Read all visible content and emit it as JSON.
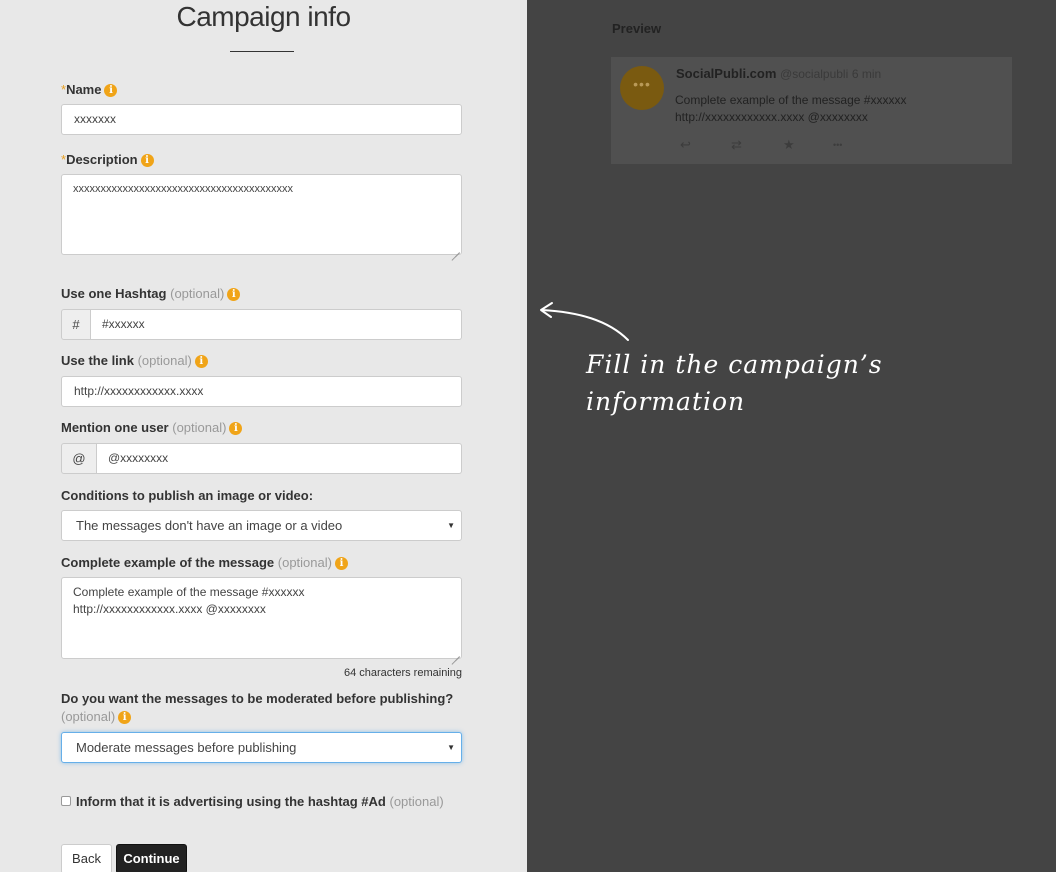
{
  "form": {
    "title": "Campaign info",
    "name": {
      "required_mark": "*",
      "label": "Name",
      "value": "xxxxxxx"
    },
    "description": {
      "required_mark": "*",
      "label": "Description",
      "value": "xxxxxxxxxxxxxxxxxxxxxxxxxxxxxxxxxxxxxxxx"
    },
    "hashtag": {
      "label": "Use one Hashtag",
      "optional": "(optional)",
      "addon": "#",
      "value": "#xxxxxx"
    },
    "link": {
      "label": "Use the link",
      "optional": "(optional)",
      "value": "http://xxxxxxxxxxxx.xxxx"
    },
    "mention": {
      "label": "Mention one user",
      "optional": "(optional)",
      "addon": "@",
      "value": "@xxxxxxxx"
    },
    "conditions": {
      "label": "Conditions to publish an image or video:",
      "selected": "The messages don't have an image or a video"
    },
    "example": {
      "label": "Complete example of the message",
      "optional": "(optional)",
      "line1": "Complete example of the message #xxxxxx",
      "line2": "http://xxxxxxxxxxxx.xxxx @xxxxxxxx",
      "remaining": "64 characters remaining"
    },
    "moderation": {
      "label": "Do you want the messages to be moderated before publishing?",
      "optional": "(optional)",
      "selected": "Moderate messages before publishing"
    },
    "advertising": {
      "label": "Inform that it is advertising using the hashtag #Ad",
      "optional": "(optional)",
      "checked": false
    },
    "buttons": {
      "back": "Back",
      "continue": "Continue"
    },
    "info_glyph": "i",
    "caret_glyph": "▼"
  },
  "preview": {
    "label": "Preview",
    "name": "SocialPubli.com",
    "handle": "@socialpubli",
    "time": "6 min",
    "text_line1": "Complete example of the message #xxxxxx",
    "text_line2": "http://xxxxxxxxxxxx.xxxx @xxxxxxxx",
    "avatar_dots": "•••",
    "avatar_color": "#7a5a10",
    "actions": {
      "reply": "↩",
      "retweet": "⇄",
      "favorite": "★",
      "more": "•••"
    }
  },
  "annotation": {
    "line1": "Fill in the campaign’s",
    "line2": "information"
  },
  "colors": {
    "info_badge": "#f0a418",
    "required": "#e8a020",
    "focus_border": "#66afe9",
    "continue_bg": "#222222"
  }
}
